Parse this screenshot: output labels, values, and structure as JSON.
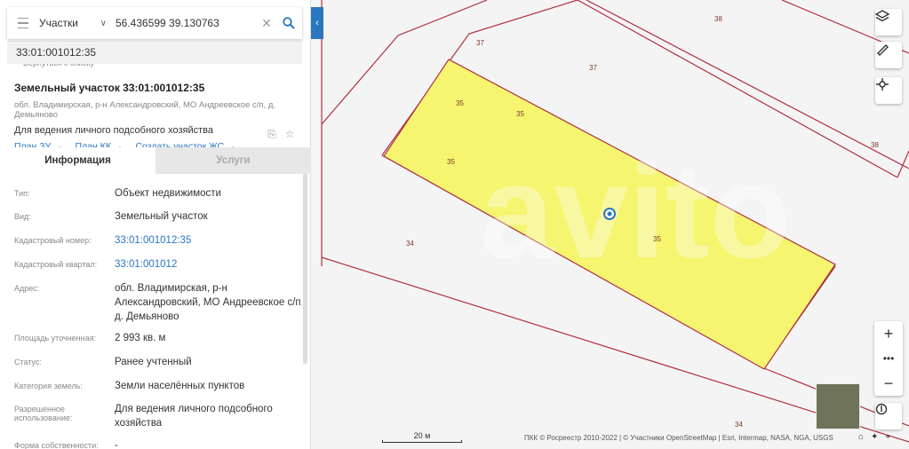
{
  "search": {
    "type_label": "Участки",
    "query": "56.436599 39.130763",
    "suggestion": "33:01:001012:35",
    "back_link": "Вернуться к списку"
  },
  "object": {
    "title": "Земельный участок 33:01:001012:35",
    "address": "обл. Владимирская, р-н Александровский, МО Андреевское с/п, д. Демьяново",
    "purpose": "Для ведения личного подсобного хозяйства",
    "links": [
      "План ЗУ →",
      "План КК →",
      "Создать участок ЖС →"
    ]
  },
  "tabs": {
    "info": "Информация",
    "services": "Услуги"
  },
  "info_rows": [
    {
      "label": "Тип:",
      "value": "Объект недвижимости",
      "link": false
    },
    {
      "label": "Вид:",
      "value": "Земельный участок",
      "link": false
    },
    {
      "label": "Кадастровый номер:",
      "value": "33:01:001012:35",
      "link": true
    },
    {
      "label": "Кадастровый квартал:",
      "value": "33:01:001012",
      "link": true
    },
    {
      "label": "Адрес:",
      "value": "обл. Владимирская, р-н Александровский, МО Андреевское с/п, д. Демьяново",
      "link": false
    },
    {
      "label": "Площадь уточненная:",
      "value": "2 993 кв. м",
      "link": false
    },
    {
      "label": "Статус:",
      "value": "Ранее учтенный",
      "link": false
    },
    {
      "label": "Категория земель:",
      "value": "Земли населённых пунктов",
      "link": false
    },
    {
      "label": "Разрешенное использование:",
      "value": "Для ведения личного подсобного хозяйства",
      "link": false
    },
    {
      "label": "Форма собственности:",
      "value": "-",
      "link": false
    }
  ],
  "map": {
    "labels": {
      "p38a": "38",
      "p37a": "37",
      "p37b": "37",
      "p38b": "38",
      "p35a": "35",
      "p35b": "35",
      "p35c": "35",
      "p35d": "35",
      "p34a": "34",
      "p34b": "34"
    },
    "scale": "20 м",
    "attribution": "ПКК © Росреестр 2010-2022 | © Участники OpenStreetMap | Esri, Intermap, NASA, NGA, USGS",
    "colors": {
      "parcel_fill": "#f5f570",
      "boundary": "#b03040",
      "accent": "#2a76c0"
    }
  }
}
